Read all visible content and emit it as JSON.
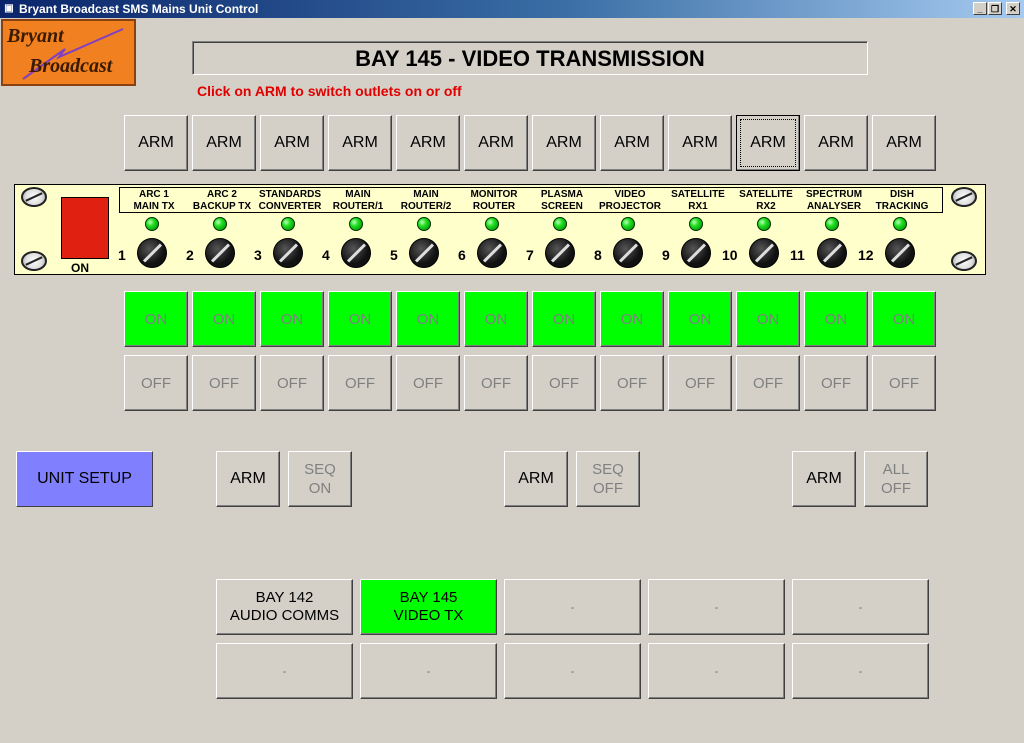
{
  "window": {
    "title": "Bryant Broadcast SMS Mains Unit Control",
    "min": "_",
    "restore": "❐",
    "close": "✕"
  },
  "logo": {
    "line1": "Bryant",
    "line2": "Broadcast"
  },
  "bay_title": "BAY 145 - VIDEO TRANSMISSION",
  "hint": "Click on ARM to switch outlets on or off",
  "arm_label": "ARM",
  "on_label": "ON",
  "off_label": "OFF",
  "power_label": "ON",
  "channels": [
    {
      "num": "1",
      "label": "ARC 1\nMAIN TX"
    },
    {
      "num": "2",
      "label": "ARC 2\nBACKUP TX"
    },
    {
      "num": "3",
      "label": "STANDARDS\nCONVERTER"
    },
    {
      "num": "4",
      "label": "MAIN\nROUTER/1"
    },
    {
      "num": "5",
      "label": "MAIN\nROUTER/2"
    },
    {
      "num": "6",
      "label": "MONITOR\nROUTER"
    },
    {
      "num": "7",
      "label": "PLASMA\nSCREEN"
    },
    {
      "num": "8",
      "label": "VIDEO\nPROJECTOR"
    },
    {
      "num": "9",
      "label": "SATELLITE\nRX1"
    },
    {
      "num": "10",
      "label": "SATELLITE\nRX2"
    },
    {
      "num": "11",
      "label": "SPECTRUM\nANALYSER"
    },
    {
      "num": "12",
      "label": "DISH\nTRACKING"
    }
  ],
  "unit_setup": "UNIT SETUP",
  "sequence": {
    "arm": "ARM",
    "seq_on": "SEQ\nON",
    "seq_off": "SEQ\nOFF",
    "all_off": "ALL\nOFF"
  },
  "bays": [
    "BAY 142\nAUDIO COMMS",
    "BAY 145\nVIDEO TX",
    "-",
    "-",
    "-",
    "-",
    "-",
    "-",
    "-",
    "-"
  ],
  "colors": {
    "on": "#00ff00",
    "setup": "#8080ff",
    "hint": "#e00000",
    "panel": "#ffffcc"
  }
}
